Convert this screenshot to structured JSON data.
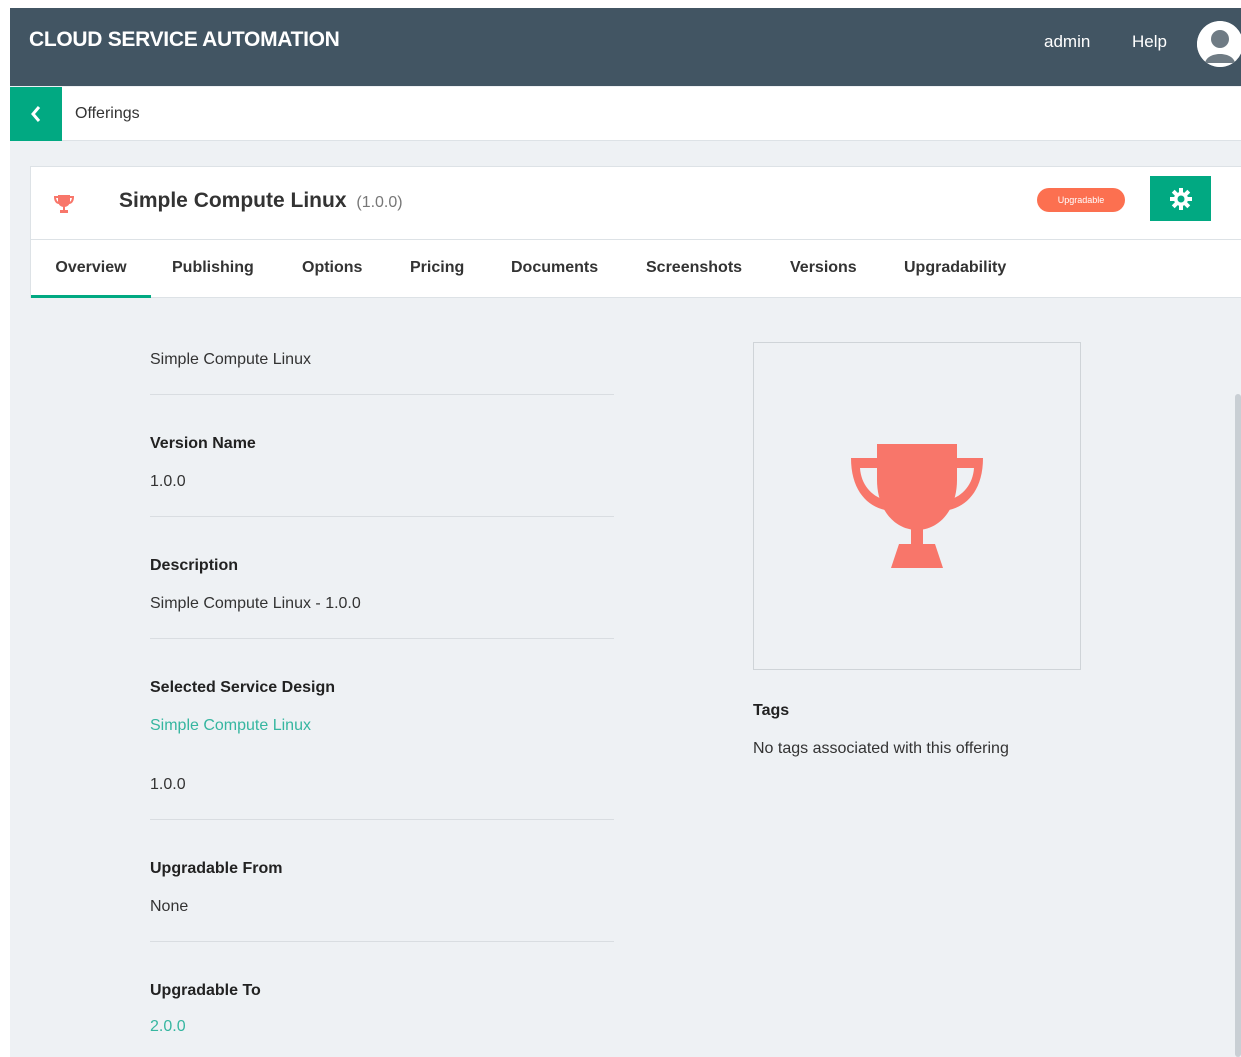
{
  "header": {
    "brand": "CLOUD SERVICE AUTOMATION",
    "admin_label": "admin",
    "help_label": "Help",
    "avatar_icon": "user-avatar-icon"
  },
  "breadcrumb": {
    "back_icon": "chevron-left-icon",
    "label": "Offerings"
  },
  "offering": {
    "icon": "trophy-icon",
    "title": "Simple Compute Linux",
    "version": "(1.0.0)",
    "badge": "Upgradable",
    "settings_icon": "gear-icon"
  },
  "tabs": [
    {
      "label": "Overview",
      "active": true
    },
    {
      "label": "Publishing",
      "active": false
    },
    {
      "label": "Options",
      "active": false
    },
    {
      "label": "Pricing",
      "active": false
    },
    {
      "label": "Documents",
      "active": false
    },
    {
      "label": "Screenshots",
      "active": false
    },
    {
      "label": "Versions",
      "active": false
    },
    {
      "label": "Upgradability",
      "active": false
    }
  ],
  "overview": {
    "display_name_value": "Simple Compute Linux",
    "version_name_label": "Version Name",
    "version_name_value": "1.0.0",
    "description_label": "Description",
    "description_value": "Simple Compute Linux - 1.0.0",
    "service_design_label": "Selected Service Design",
    "service_design_link": "Simple Compute Linux",
    "service_design_version": "1.0.0",
    "upgradable_from_label": "Upgradable From",
    "upgradable_from_value": "None",
    "upgradable_to_label": "Upgradable To",
    "upgradable_to_link": "2.0.0",
    "tags_label": "Tags",
    "tags_value": "No tags associated with this offering",
    "image_icon": "trophy-icon"
  },
  "colors": {
    "header_bg": "#425563",
    "accent_green": "#01a982",
    "badge_orange": "#fc7050",
    "trophy": "#f8766a",
    "link": "#36b6a0"
  }
}
